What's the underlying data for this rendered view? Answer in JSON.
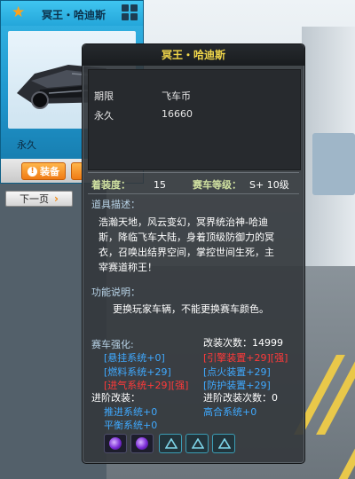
{
  "card": {
    "title": "冥王・哈迪斯",
    "subtitle": "永久",
    "equip_label": "装备"
  },
  "next_page_label": "下一页",
  "tooltip": {
    "title": "冥王・哈迪斯",
    "price_rows": [
      {
        "label": "期限",
        "value": "飞车币"
      },
      {
        "label": "永久",
        "value": "16660"
      }
    ],
    "equip_level_label": "着装度：",
    "equip_level_value": "15",
    "car_level_label": "赛车等级：",
    "car_level_value": "S+ 10级",
    "desc_label": "道具描述：",
    "desc_lines": [
      "浩瀚天地，风云变幻，冥界统治神-哈迪",
      "斯，降临飞车大陆，身着顶级防御力的冥",
      "衣，召唤出结界空间，掌控世间生死，主",
      "宰赛道称王！"
    ],
    "func_label": "功能说明：",
    "func_text": "更换玩家车辆，不能更换赛车颜色。",
    "strengthen_label": "赛车强化:",
    "mod_count_label": "改装次数：14999",
    "mods_left": [
      "[悬挂系统+0]",
      "[燃料系统+29]",
      "[进气系统+29][强]"
    ],
    "mods_right": [
      "[引擎装置+29][强]",
      "[点火装置+29]",
      "[防护装置+29]"
    ],
    "advanced_label": "进阶改装：",
    "advanced_count_label": "进阶改装次数：0",
    "advanced_left": [
      "推进系统+0",
      "平衡系统+0"
    ],
    "advanced_right": [
      "高合系统+0"
    ]
  },
  "colors": {
    "title_gold": "#f3d84a",
    "mod_blue": "#3fa9ff",
    "mod_red": "#ff3a3a",
    "card_blue": "#24a6da",
    "equip_orange": "#f07b14"
  },
  "icons": [
    "star-icon",
    "grid-icon",
    "exclamation-icon",
    "chevron-right-icon",
    "purple-orb-icon",
    "triangle-icon"
  ]
}
